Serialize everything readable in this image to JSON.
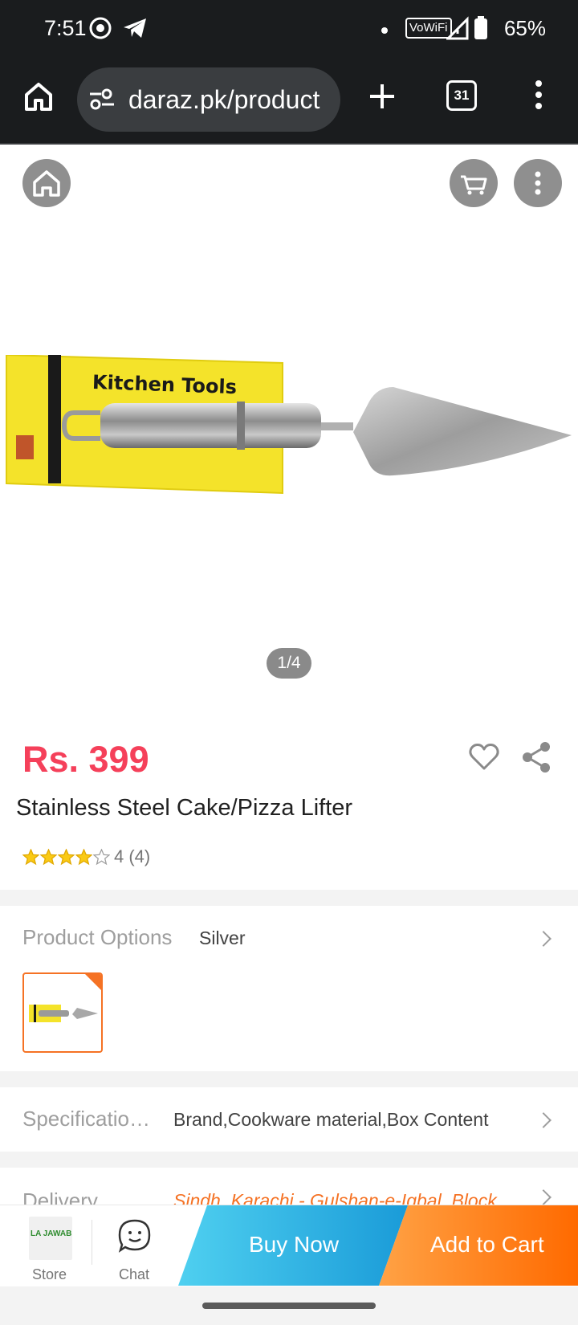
{
  "status_bar": {
    "time": "7:51",
    "wifi_label": "VoWiFi",
    "battery": "65%"
  },
  "browser": {
    "url": "daraz.pk/product",
    "tab_count": "31"
  },
  "product": {
    "image_counter": "1/4",
    "image_label": "Kitchen Tools",
    "price": "Rs. 399",
    "title": "Stainless Steel Cake/Pizza Lifter",
    "rating_value": 4,
    "rating_max": 5,
    "rating_text": "4 (4)"
  },
  "options": {
    "label": "Product Options",
    "value": "Silver"
  },
  "specifications": {
    "label": "Specificatio…",
    "value": "Brand,Cookware material,Box Content"
  },
  "delivery": {
    "label": "Delivery",
    "value": "Sindh, Karachi - Gulshan-e-Iqbal, Block"
  },
  "action_bar": {
    "store_label": "Store",
    "store_logo_text": "LA JAWAB",
    "chat_label": "Chat",
    "buy_now": "Buy Now",
    "add_to_cart": "Add to Cart"
  },
  "colors": {
    "price": "#f5405a",
    "accent_orange": "#f57224",
    "buy_now": "#1a9bd8",
    "add_to_cart": "#ff6a00"
  },
  "icons": [
    "circle-at-icon",
    "telegram-icon",
    "dot-icon",
    "signal-icon",
    "battery-icon",
    "home-icon",
    "site-settings-icon",
    "plus-icon",
    "tabs-icon",
    "kebab-menu-icon",
    "cart-icon",
    "heart-icon",
    "share-icon",
    "star-icon",
    "chevron-right-icon",
    "chat-icon"
  ]
}
